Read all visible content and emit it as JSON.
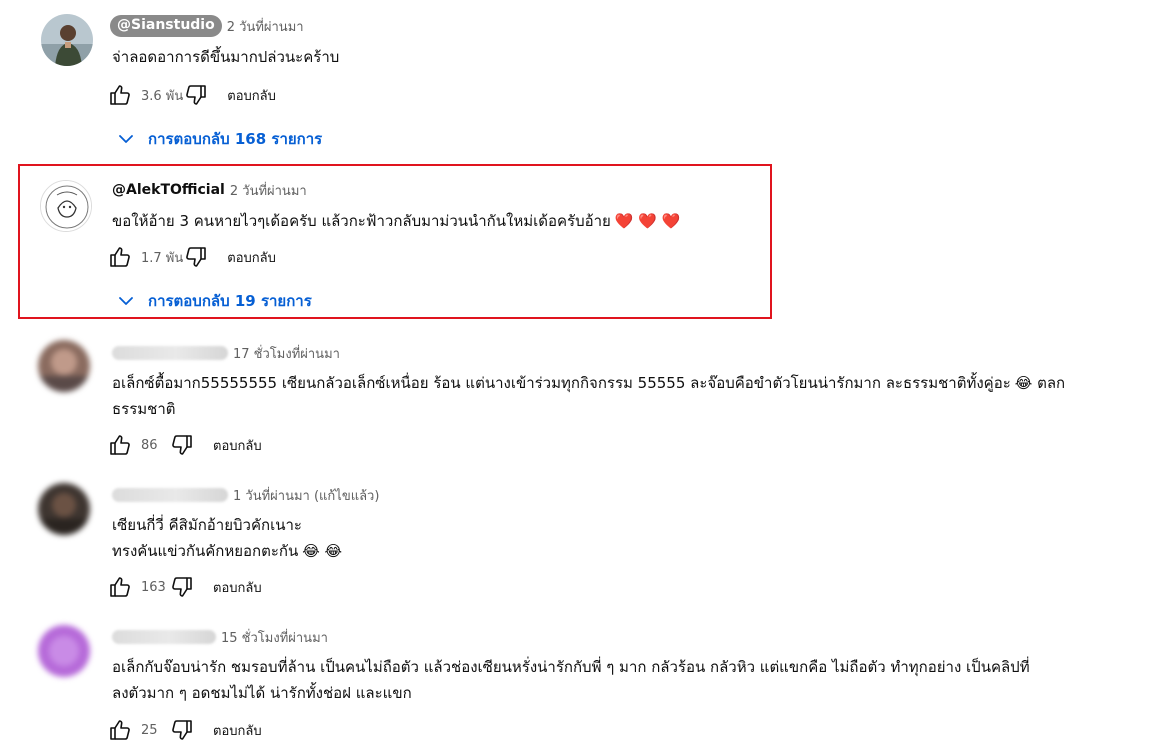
{
  "comments": [
    {
      "author": "@Sianstudio",
      "time": "2 วันที่ผ่านมา",
      "lines": [
        "จ่าลอดอาการดีขึ้นมากปล่วนะคร้าบ"
      ],
      "likes": "3.6 พัน",
      "reply_label": "ตอบกลับ",
      "replies_label": "การตอบกลับ 168 รายการ",
      "avatar_icon": "avatar-photo-person"
    },
    {
      "author": "@AlekTOfficial",
      "time": "2 วันที่ผ่านมา",
      "lines": [
        "ขอให้อ้าย 3 คนหายไวๆเด้อครับ แล้วกะฟ้าวกลับมาม่วนนำกันใหม่เด้อครับอ้าย"
      ],
      "line_emoji": "❤️ ❤️ ❤️",
      "likes": "1.7 พัน",
      "reply_label": "ตอบกลับ",
      "replies_label": "การตอบกลับ 19 รายการ",
      "avatar_icon": "avatar-logo-drawing",
      "highlighted": true
    },
    {
      "time": "17 ชั่วโมงที่ผ่านมา",
      "lines": [
        "อเล็กซ์ตื้อมาก55555555 เซียนกลัวอเล็กซ์เหนื่อย ร้อน แต่นางเข้าร่วมทุกกิจกรรม 55555 ละจ๊อบคือขำตัวโยนน่ารักมาก ละธรรมชาติทั้งคู่อะ",
        "ธรรมชาติ"
      ],
      "line1_emoji": "😂",
      "line1_tail": "ตลก",
      "likes": "86",
      "reply_label": "ตอบกลับ",
      "avatar_icon": "avatar-blurred"
    },
    {
      "time": "1 วันที่ผ่านมา (แก้ไขแล้ว)",
      "lines": [
        "เซียนกี่วี่ คีสิมักอ้ายบิวคักเนาะ",
        "ทรงคันแข่วกันคักหยอกตะกัน"
      ],
      "line2_emoji": "😂 😂",
      "likes": "163",
      "reply_label": "ตอบกลับ",
      "avatar_icon": "avatar-blurred"
    },
    {
      "time": "15 ชั่วโมงที่ผ่านมา",
      "lines": [
        "อเล็กกับจ๊อบน่ารัก ชมรอบที่ล้าน เป็นคนไม่ถือตัว แล้วช่องเซียนหรั่งน่ารักกับพี่ ๆ มาก กลัวร้อน กลัวหิว แต่แขกคือ ไม่ถือตัว ทำทุกอย่าง เป็นคลิปที่",
        "ลงตัวมาก ๆ อดชมไม่ได้ น่ารักทั้งช่อฝ และแขก"
      ],
      "likes": "25",
      "reply_label": "ตอบกลับ",
      "avatar_icon": "avatar-blurred"
    }
  ],
  "icons": {
    "like": "thumbs-up-icon",
    "dislike": "thumbs-down-icon",
    "expand": "chevron-down-icon"
  },
  "colors": {
    "link_blue": "#065fd4",
    "highlight_red": "#e0141e",
    "secondary_text": "#606060",
    "author_chip": "#8a8a8a"
  }
}
